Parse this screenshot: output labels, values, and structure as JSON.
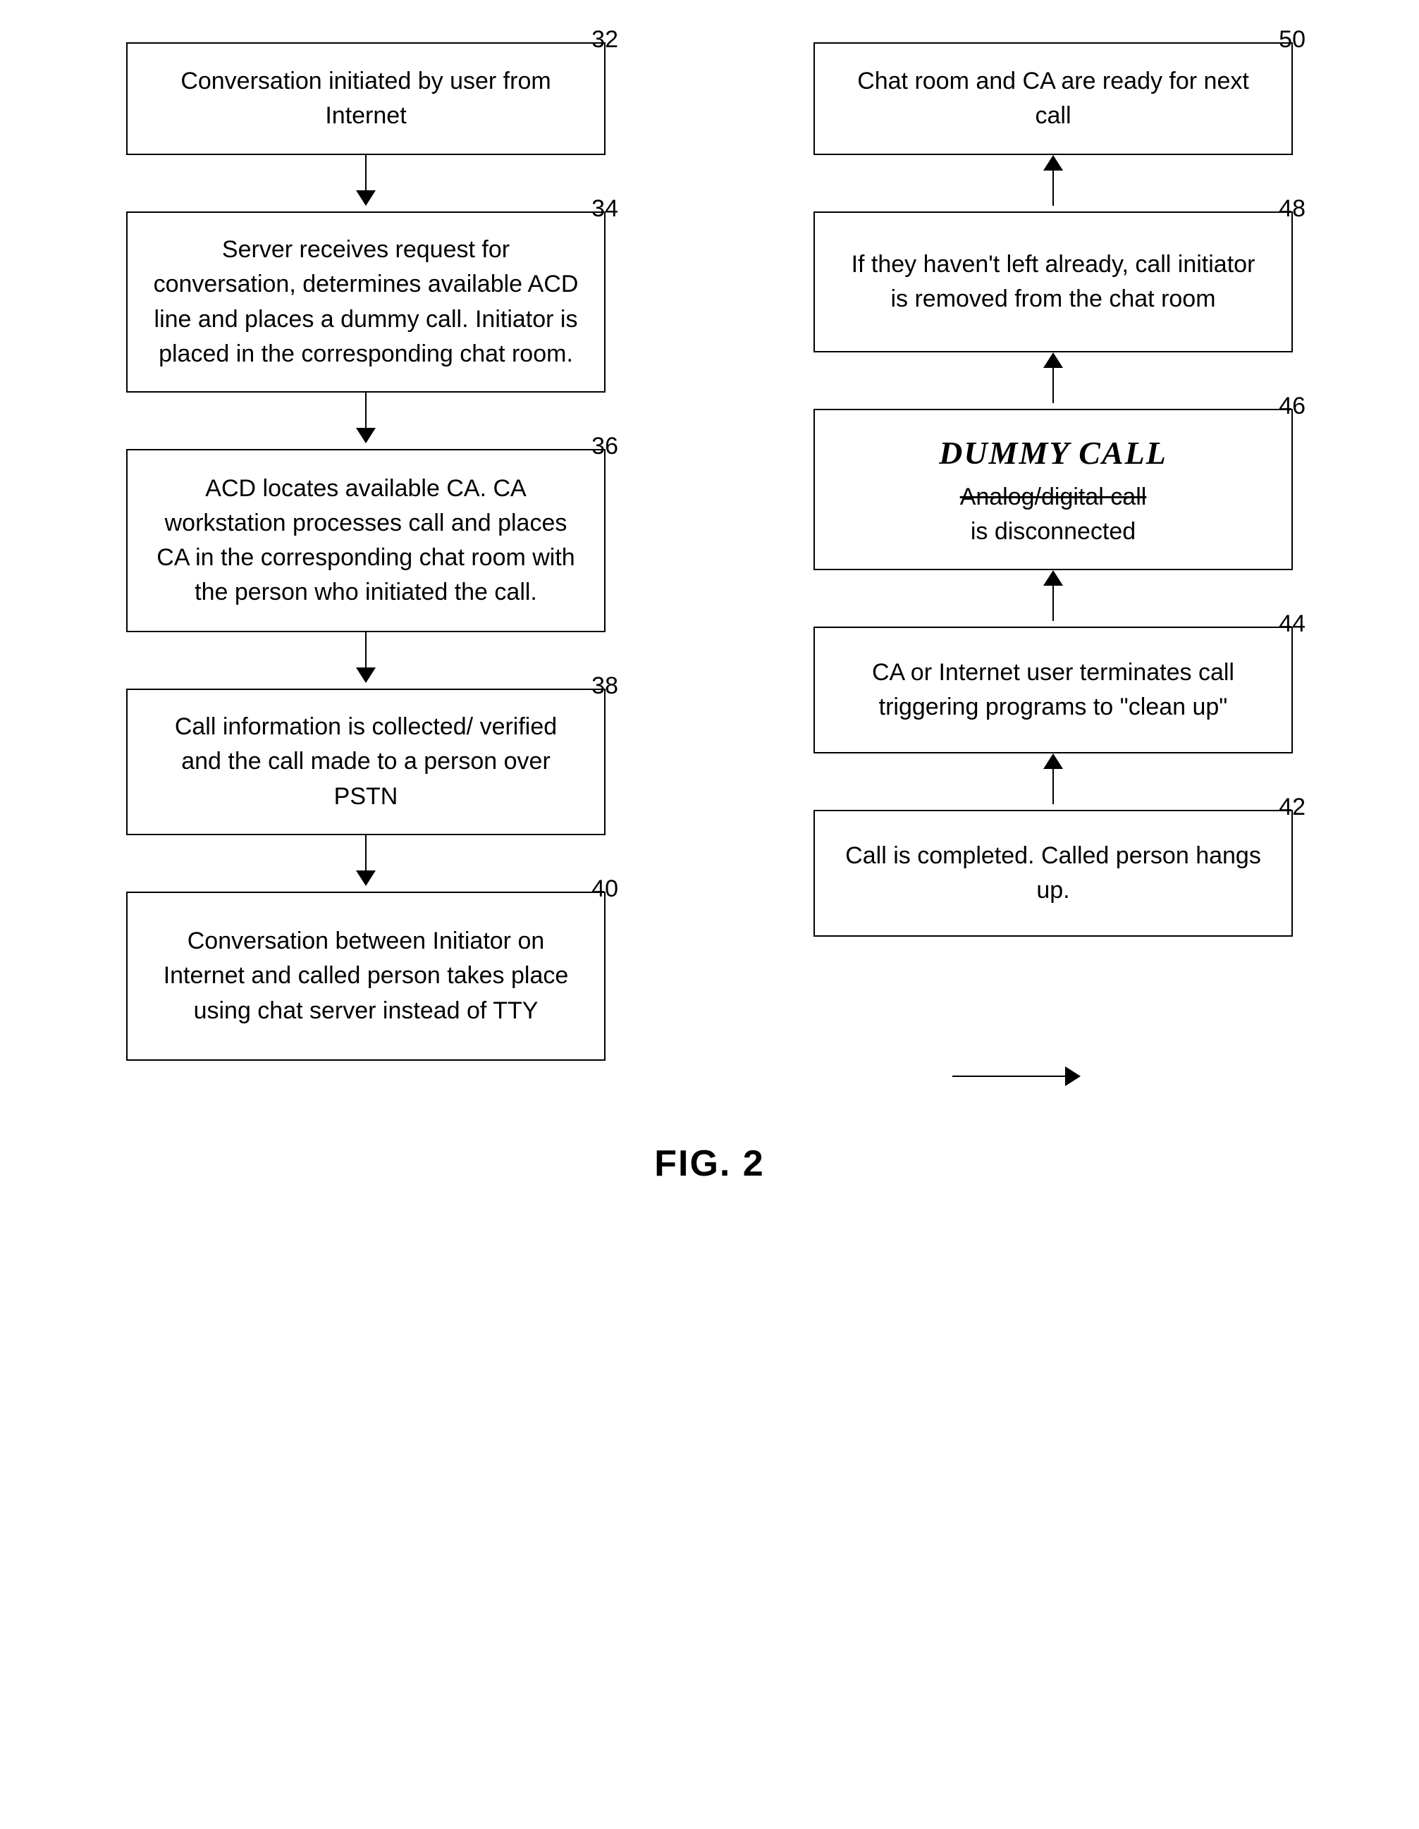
{
  "figure": {
    "label": "FIG. 2"
  },
  "boxes": {
    "b32": {
      "label": "32",
      "text": "Conversation initiated by user from Internet"
    },
    "b34": {
      "label": "34",
      "text": "Server receives request for conversation, determines available ACD line and places a dummy call.  Initiator is placed in the corresponding chat room."
    },
    "b36": {
      "label": "36",
      "text": "ACD locates available CA. CA workstation processes call and places CA in the corresponding chat room with the person who initiated the call."
    },
    "b38": {
      "label": "38",
      "text": "Call information is collected/ verified and the call made to a person over PSTN"
    },
    "b40": {
      "label": "40",
      "text": "Conversation between Initiator on Internet and called person takes place using chat server instead of TTY"
    },
    "b42": {
      "label": "42",
      "text": "Call is completed. Called person hangs up."
    },
    "b44": {
      "label": "44",
      "text": "CA or Internet user terminates call triggering programs to \"clean up\""
    },
    "b46": {
      "label": "46",
      "text_handwritten": "DUMMY CALL",
      "text_strikethrough": "Analog/digital call",
      "text_normal": "is disconnected"
    },
    "b48": {
      "label": "48",
      "text": "If they haven't left already, call initiator is removed from the chat room"
    },
    "b50": {
      "label": "50",
      "text": "Chat room and CA are ready for next call"
    }
  },
  "arrows": {
    "down_label": "↓",
    "up_label": "↑",
    "right_label": "→"
  }
}
